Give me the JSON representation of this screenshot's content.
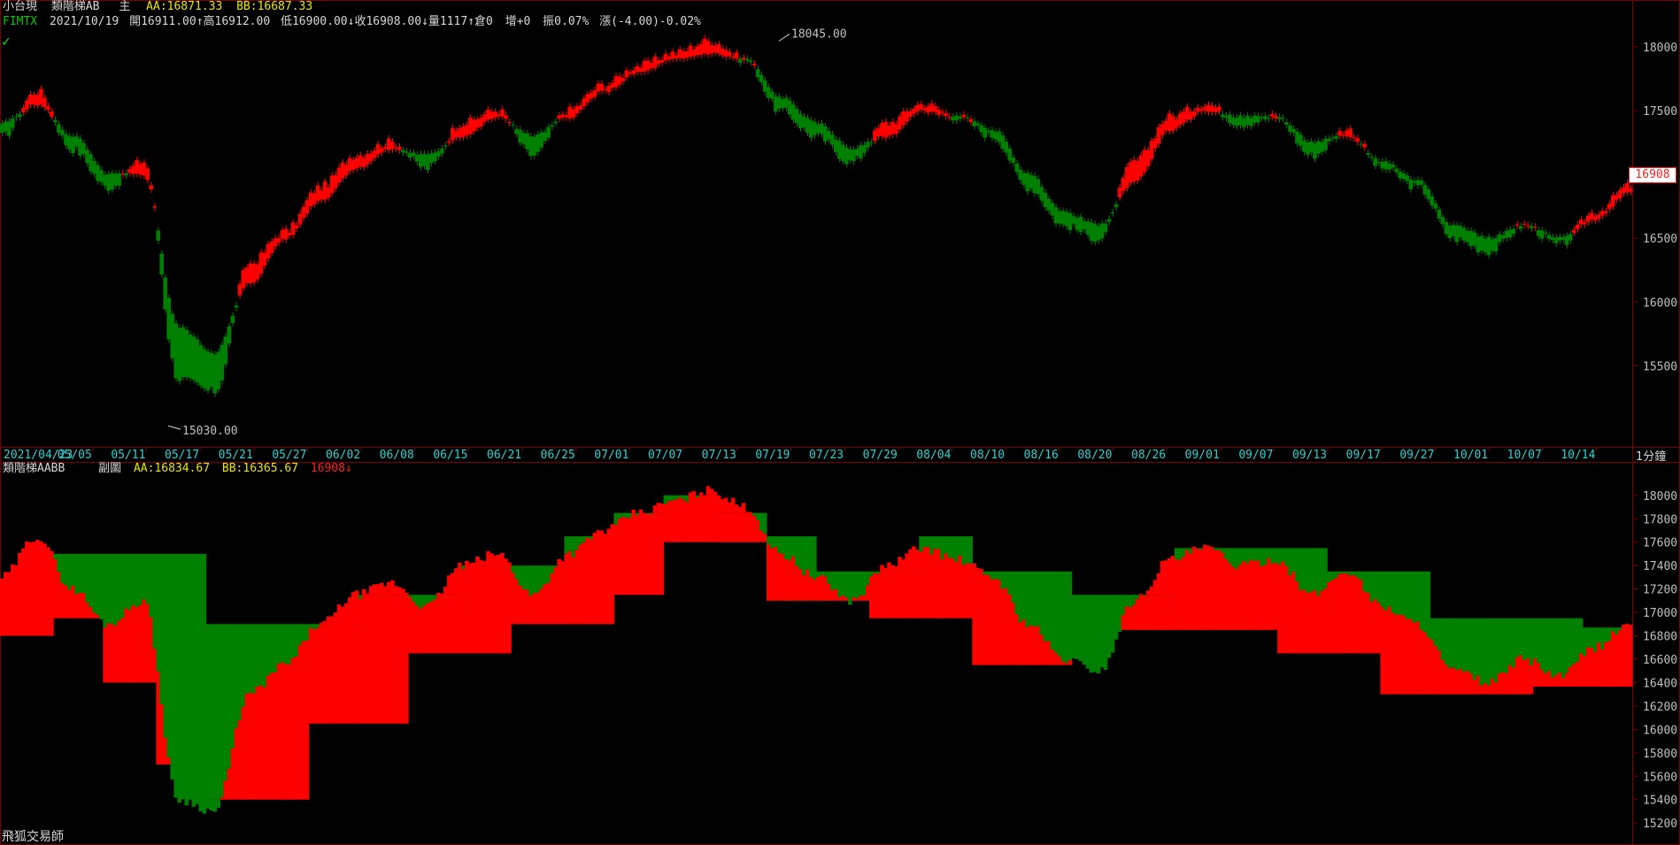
{
  "main_header": {
    "symbol_name": "小台現",
    "indicator": "類階梯AB",
    "pane_label": "主",
    "aa": "AA:16871.33",
    "bb": "BB:16687.33"
  },
  "quote_header": {
    "ticker": "FIMTX",
    "date": "2021/10/19",
    "open": "開16911.00",
    "high": "高16912.00",
    "low": "低16900.00",
    "close": "收16908.00",
    "volume": "量1117",
    "position": "倉0",
    "change_pos": "增+0",
    "amplitude": "振0.07%",
    "rise": "漲(-4.00)-0.02%"
  },
  "annotations": {
    "high_marker": "18045.00",
    "low_marker": "15030.00",
    "last_price": "16908"
  },
  "sub_header": {
    "indicator": "類階梯AABB",
    "pane_label": "副圖",
    "aa": "AA:16834.67",
    "bb": "BB:16365.67",
    "last": "16908",
    "arrow": "↓"
  },
  "period_label": "1分鐘",
  "footer": "飛狐交易師",
  "colors": {
    "up": "#ff0000",
    "down": "#008000",
    "frame": "#7a0000",
    "dates": "#2fd0d0"
  },
  "chart_data": [
    {
      "type": "area",
      "title": "類階梯AB",
      "ylim": [
        14900,
        18200
      ],
      "yticks": [
        15500,
        16000,
        16500,
        17000,
        17500,
        18000
      ],
      "x_labels": [
        "2021/04/23",
        "05/05",
        "05/11",
        "05/17",
        "05/21",
        "05/27",
        "06/02",
        "06/08",
        "06/15",
        "06/21",
        "06/25",
        "07/01",
        "07/07",
        "07/13",
        "07/19",
        "07/23",
        "07/29",
        "08/04",
        "08/10",
        "08/16",
        "08/20",
        "08/26",
        "09/01",
        "09/07",
        "09/13",
        "09/17",
        "09/27",
        "10/01",
        "10/07",
        "10/14"
      ],
      "series": [
        {
          "name": "price",
          "values": [
            17300,
            17650,
            17200,
            16900,
            17100,
            15400,
            15300,
            16300,
            16550,
            16900,
            17150,
            17250,
            17050,
            17400,
            17500,
            17150,
            17500,
            17700,
            17850,
            17950,
            18045,
            17900,
            17500,
            17300,
            17100,
            17400,
            17550,
            17450,
            17300,
            16900,
            16600,
            16500,
            17100,
            17450,
            17550,
            17400,
            17450,
            17150,
            17350,
            17050,
            16900,
            16500,
            16400,
            16600,
            16450,
            16700,
            16908
          ]
        },
        {
          "name": "AA",
          "values": [
            17400,
            17550,
            17300,
            17000,
            17000,
            15800,
            15600,
            16150,
            16500,
            16800,
            17050,
            17200,
            17150,
            17300,
            17450,
            17300,
            17450,
            17650,
            17800,
            17900,
            17950,
            17900,
            17600,
            17400,
            17200,
            17300,
            17500,
            17450,
            17350,
            17000,
            16700,
            16600,
            16950,
            17350,
            17500,
            17450,
            17450,
            17250,
            17300,
            17100,
            16950,
            16600,
            16500,
            16600,
            16500,
            16650,
            16871
          ]
        }
      ]
    },
    {
      "type": "area",
      "title": "類階梯AABB",
      "ylim": [
        15050,
        18150
      ],
      "yticks": [
        15200,
        15400,
        15600,
        15800,
        16000,
        16200,
        16400,
        16600,
        16800,
        17000,
        17200,
        17400,
        17600,
        17800,
        18000
      ],
      "series": [
        {
          "name": "AA",
          "values": [
            17000,
            17500,
            17500,
            17500,
            16900,
            16900,
            16900,
            17150,
            17150,
            17400,
            17400,
            17650,
            17850,
            18000,
            17850,
            17650,
            17350,
            17350,
            17650,
            17350,
            17350,
            17150,
            17150,
            17550,
            17550,
            17550,
            17350,
            17350,
            16950,
            16950,
            16950,
            16871
          ]
        },
        {
          "name": "BB",
          "values": [
            16800,
            16950,
            16400,
            15700,
            15400,
            15400,
            16050,
            16050,
            16650,
            16650,
            16900,
            16900,
            17150,
            17600,
            17600,
            17100,
            17100,
            16950,
            16950,
            16550,
            16550,
            16850,
            16850,
            16850,
            16850,
            16650,
            16650,
            16300,
            16300,
            16300,
            16365,
            16365
          ]
        }
      ]
    }
  ]
}
